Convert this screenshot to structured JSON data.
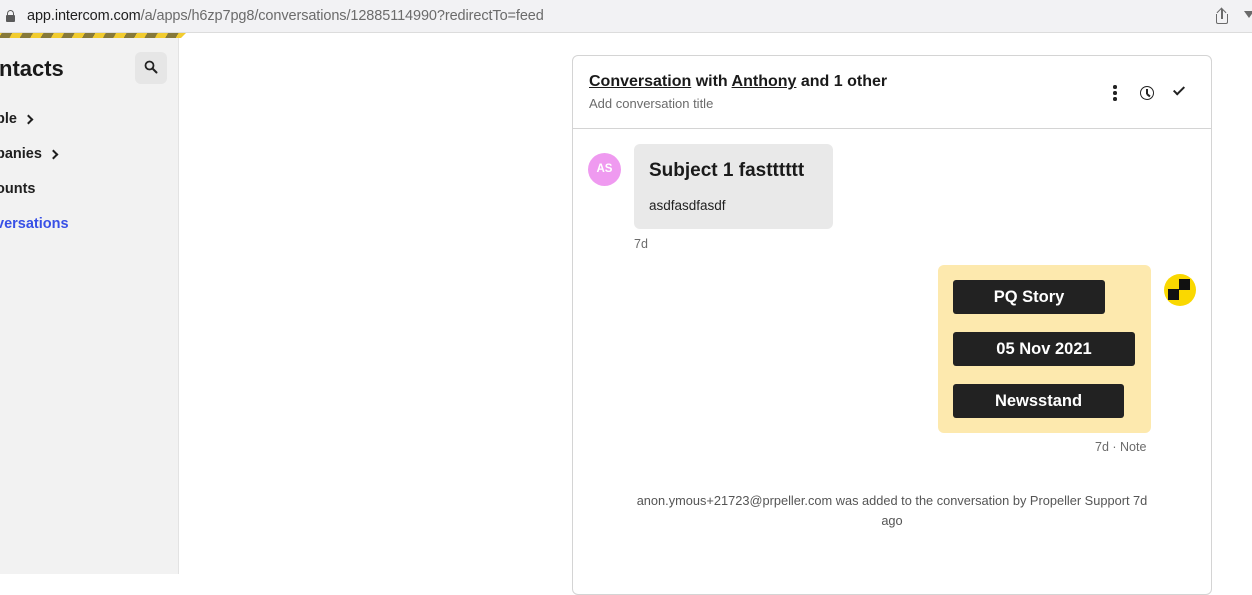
{
  "browser": {
    "url_host": "app.intercom.com",
    "url_path": "/a/apps/h6zp7pg8/conversations/12885114990?redirectTo=feed",
    "icons": [
      "lock-icon",
      "share-icon",
      "filter-icon"
    ]
  },
  "sidebar": {
    "title": "ntacts",
    "search_icon": "search-icon",
    "items": [
      {
        "label": "ple",
        "has_chevron": true,
        "active": false
      },
      {
        "label": "panies",
        "has_chevron": true,
        "active": false
      },
      {
        "label": "ounts",
        "has_chevron": false,
        "active": false
      },
      {
        "label": "versations",
        "has_chevron": false,
        "active": true
      }
    ],
    "active_color": "#3850e6"
  },
  "conversation": {
    "title_link1": "Conversation",
    "title_mid": " with ",
    "title_link2": "Anthony",
    "title_tail": " and 1 other",
    "subtitle": "Add conversation title",
    "actions": [
      "more-options-icon",
      "snooze-clock-icon",
      "close-check-icon"
    ],
    "messages": [
      {
        "type": "user",
        "avatar_initials": "AS",
        "avatar_color": "#ef9af0",
        "subject": "Subject 1 fastttttt",
        "body": "asdfasdfasdf",
        "time": "7d"
      },
      {
        "type": "note",
        "background": "#fde9ae",
        "tags": [
          "PQ Story",
          "05 Nov 2021",
          "Newsstand"
        ],
        "meta": "7d · Note"
      }
    ],
    "event": "anon.ymous+21723@prpeller.com was added to the conversation by Propeller Support 7d ago"
  }
}
